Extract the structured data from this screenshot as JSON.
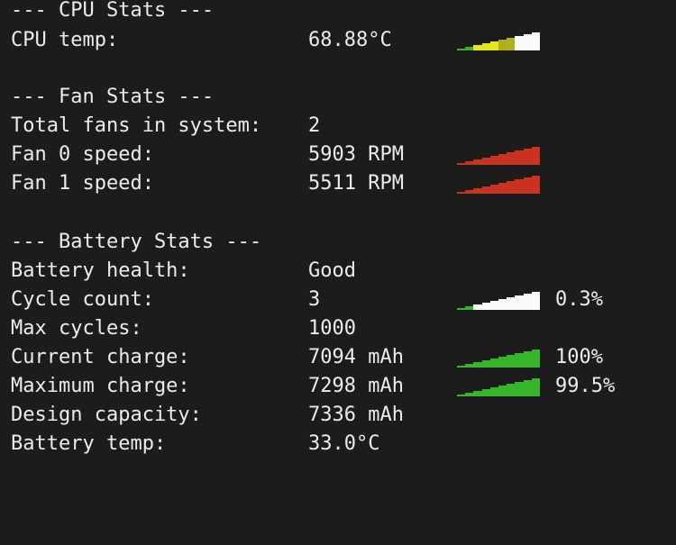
{
  "sections": {
    "cpu_header": "--- CPU Stats ---",
    "fan_header": "--- Fan Stats ---",
    "battery_header": "--- Battery Stats ---"
  },
  "cpu": {
    "temp_label": "CPU temp:",
    "temp_value": "68.88°C",
    "temp_bar": {
      "level": 0.7,
      "colors": [
        "#36b52a",
        "#36b52a",
        "#e6e61e",
        "#e6e61e",
        "#e6e61e",
        "#b0b01e",
        "#b0b01e",
        "#fafafa",
        "#fafafa",
        "#fafafa"
      ]
    }
  },
  "fans": {
    "total_label": "Total fans in system:",
    "total_value": "2",
    "fan0_label": "Fan 0 speed:",
    "fan0_value": "5903 RPM",
    "fan0_bar": {
      "level": 1.0,
      "colors": [
        "#c8321e",
        "#c8321e",
        "#c8321e",
        "#c8321e",
        "#c8321e",
        "#c8321e",
        "#c8321e",
        "#c8321e",
        "#c8321e",
        "#c8321e"
      ]
    },
    "fan1_label": "Fan 1 speed:",
    "fan1_value": "5511 RPM",
    "fan1_bar": {
      "level": 1.0,
      "colors": [
        "#c8321e",
        "#c8321e",
        "#c8321e",
        "#c8321e",
        "#c8321e",
        "#c8321e",
        "#c8321e",
        "#c8321e",
        "#c8321e",
        "#c8321e"
      ]
    }
  },
  "battery": {
    "health_label": "Battery health:",
    "health_value": "Good",
    "cycle_label": "Cycle count:",
    "cycle_value": "3",
    "cycle_pct": "0.3%",
    "cycle_bar": {
      "level": 0.003,
      "colors": [
        "#36b52a",
        "#36b52a",
        "#fafafa",
        "#fafafa",
        "#fafafa",
        "#fafafa",
        "#fafafa",
        "#fafafa",
        "#fafafa",
        "#fafafa"
      ]
    },
    "max_cycles_label": "Max cycles:",
    "max_cycles_value": "1000",
    "current_label": "Current charge:",
    "current_value": "7094 mAh",
    "current_pct": "100%",
    "current_bar": {
      "level": 1.0,
      "colors": [
        "#36b52a",
        "#36b52a",
        "#36b52a",
        "#36b52a",
        "#36b52a",
        "#36b52a",
        "#36b52a",
        "#36b52a",
        "#36b52a",
        "#36b52a"
      ]
    },
    "maximum_label": "Maximum charge:",
    "maximum_value": "7298 mAh",
    "maximum_pct": "99.5%",
    "maximum_bar": {
      "level": 0.995,
      "colors": [
        "#36b52a",
        "#36b52a",
        "#36b52a",
        "#36b52a",
        "#36b52a",
        "#36b52a",
        "#36b52a",
        "#36b52a",
        "#36b52a",
        "#36b52a"
      ]
    },
    "design_label": "Design capacity:",
    "design_value": "7336 mAh",
    "temp_label": "Battery temp:",
    "temp_value": "33.0°C"
  }
}
